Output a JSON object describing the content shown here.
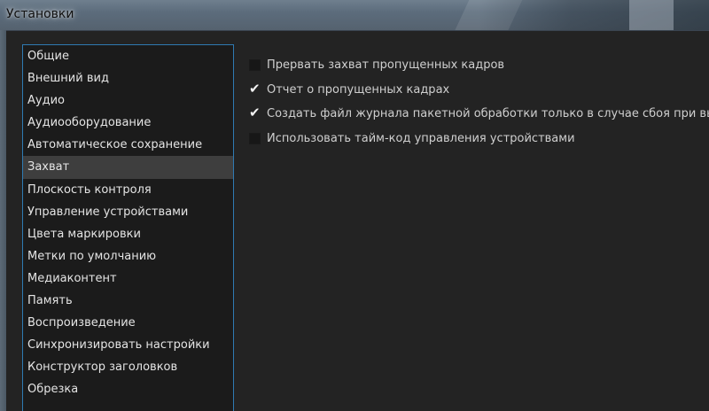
{
  "window": {
    "title": "Установки"
  },
  "categories": [
    {
      "label": "Общие",
      "selected": false
    },
    {
      "label": "Внешний вид",
      "selected": false
    },
    {
      "label": "Аудио",
      "selected": false
    },
    {
      "label": "Аудиооборудование",
      "selected": false
    },
    {
      "label": "Автоматическое сохранение",
      "selected": false
    },
    {
      "label": "Захват",
      "selected": true
    },
    {
      "label": "Плоскость контроля",
      "selected": false
    },
    {
      "label": "Управление устройствами",
      "selected": false
    },
    {
      "label": "Цвета маркировки",
      "selected": false
    },
    {
      "label": "Метки по умолчанию",
      "selected": false
    },
    {
      "label": "Медиаконтент",
      "selected": false
    },
    {
      "label": "Память",
      "selected": false
    },
    {
      "label": "Воспроизведение",
      "selected": false
    },
    {
      "label": "Синхронизировать настройки",
      "selected": false
    },
    {
      "label": "Конструктор заголовков",
      "selected": false
    },
    {
      "label": "Обрезка",
      "selected": false
    }
  ],
  "options": [
    {
      "label": "Прервать захват пропущенных кадров",
      "checked": false
    },
    {
      "label": "Отчет о пропущенных кадрах",
      "checked": true
    },
    {
      "label": "Создать файл журнала пакетной обработки только в случае сбоя при выполнении",
      "checked": true
    },
    {
      "label": "Использовать тайм-код управления устройствами",
      "checked": false
    }
  ],
  "colors": {
    "list_border": "#2f7ab2",
    "selected_bg": "#3e3e3e",
    "background": "#232323"
  }
}
